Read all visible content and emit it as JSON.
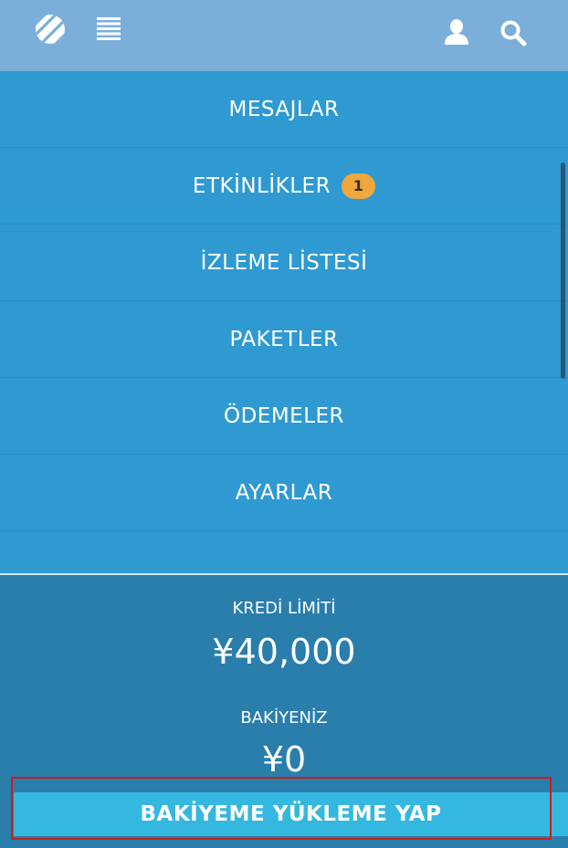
{
  "topbar": {
    "icons": [
      "globe-logo-icon",
      "list-icon",
      "user-icon",
      "search-icon"
    ]
  },
  "menu": {
    "items": [
      {
        "label": "MESAJLAR"
      },
      {
        "label": "ETKİNLİKLER",
        "badge": "1"
      },
      {
        "label": "İZLEME LİSTESİ"
      },
      {
        "label": "PAKETLER"
      },
      {
        "label": "ÖDEMELER"
      },
      {
        "label": "AYARLAR"
      }
    ]
  },
  "balance": {
    "credit_label": "KREDİ LİMİTİ",
    "credit_value": "¥40,000",
    "balance_label": "BAKİYENİZ",
    "balance_value": "¥0",
    "topup_label": "BAKİYEME YÜKLEME YAP"
  },
  "colors": {
    "topbar": "#7bafd9",
    "menu": "#2f9ad2",
    "balance_panel": "#2a7eab",
    "button": "#35b8e0",
    "badge": "#f0a73e",
    "highlight": "#d11a1a"
  }
}
